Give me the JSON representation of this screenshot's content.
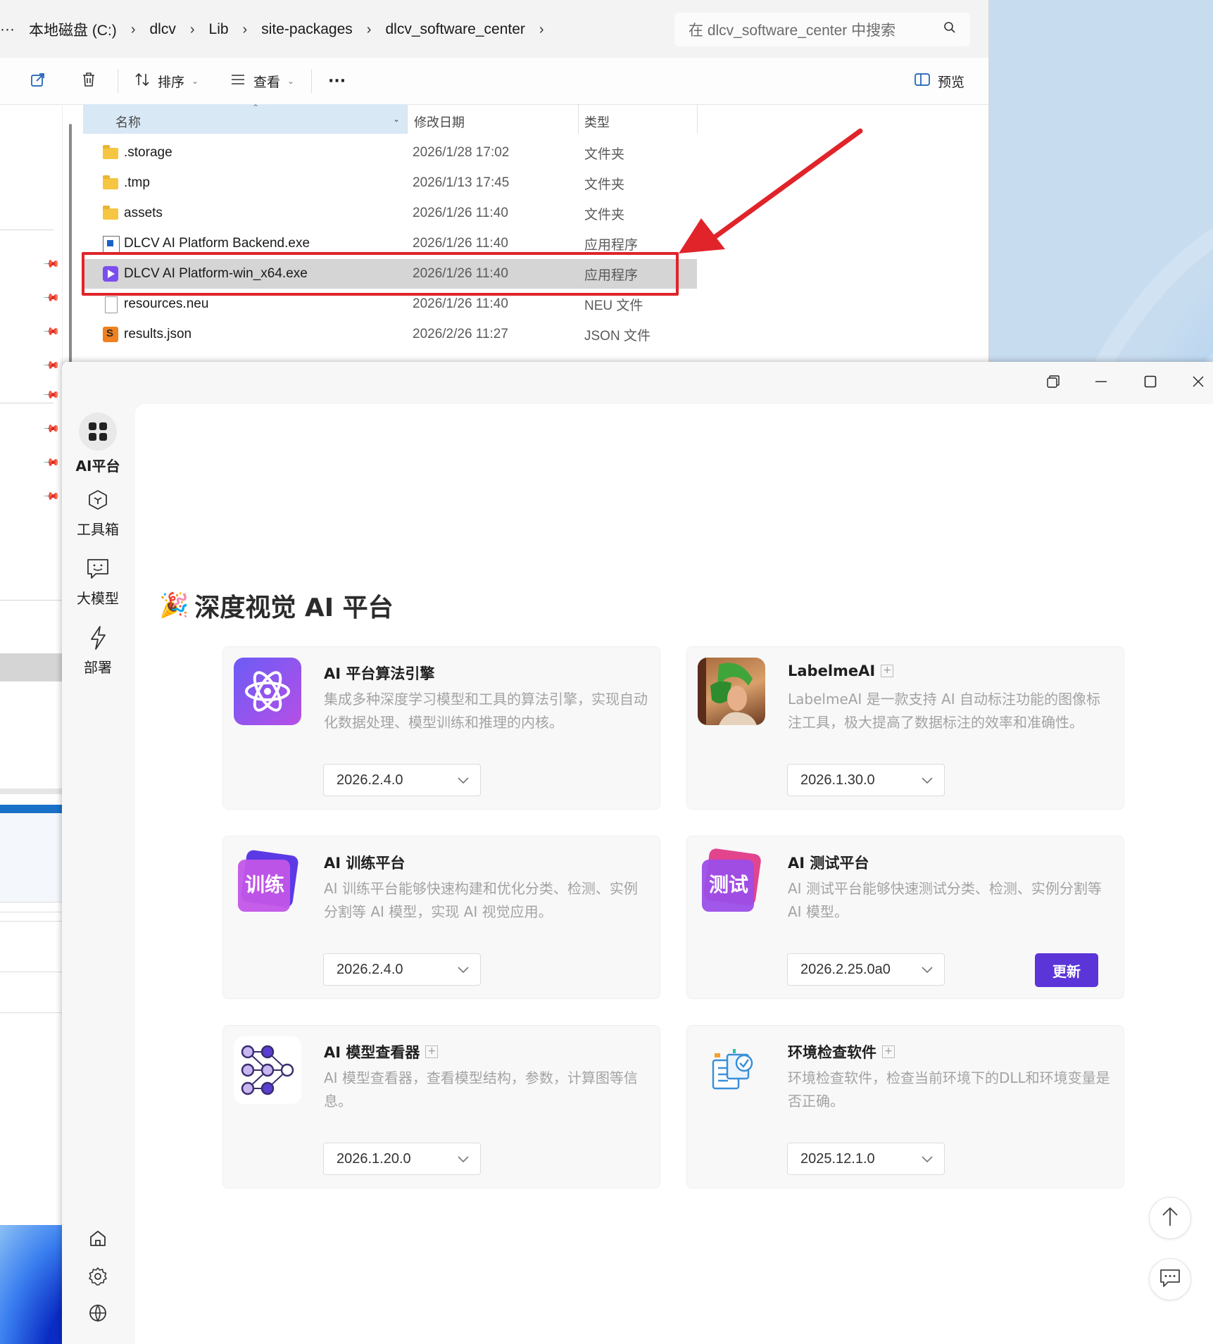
{
  "explorer": {
    "breadcrumbs": [
      "本地磁盘 (C:)",
      "dlcv",
      "Lib",
      "site-packages",
      "dlcv_software_center"
    ],
    "breadcrumb_lead": "···",
    "search_placeholder": "在 dlcv_software_center 中搜索",
    "toolbar": {
      "sort_label": "排序",
      "view_label": "查看",
      "more_label": "···",
      "preview_label": "预览"
    },
    "columns": {
      "name": "名称",
      "date": "修改日期",
      "type": "类型"
    },
    "files": [
      {
        "name": ".storage",
        "date": "2026/1/28 17:02",
        "type": "文件夹",
        "icon": "folder-icon"
      },
      {
        "name": ".tmp",
        "date": "2026/1/13 17:45",
        "type": "文件夹",
        "icon": "folder-icon"
      },
      {
        "name": "assets",
        "date": "2026/1/26 11:40",
        "type": "文件夹",
        "icon": "folder-icon"
      },
      {
        "name": "DLCV AI Platform Backend.exe",
        "date": "2026/1/26 11:40",
        "type": "应用程序",
        "icon": "exe-icon"
      },
      {
        "name": "DLCV AI Platform-win_x64.exe",
        "date": "2026/1/26 11:40",
        "type": "应用程序",
        "icon": "app-icon",
        "selected": true
      },
      {
        "name": "resources.neu",
        "date": "2026/1/26 11:40",
        "type": "NEU 文件",
        "icon": "document-icon"
      },
      {
        "name": "results.json",
        "date": "2026/2/26 11:27",
        "type": "JSON 文件",
        "icon": "json-icon"
      }
    ]
  },
  "app": {
    "sidebar": [
      {
        "label": "AI平台",
        "icon": "grid-icon",
        "active": true
      },
      {
        "label": "工具箱",
        "icon": "cube-icon"
      },
      {
        "label": "大模型",
        "icon": "chat-icon"
      },
      {
        "label": "部署",
        "icon": "bolt-icon"
      }
    ],
    "page_title": "深度视觉 AI 平台",
    "title_emoji": "🎉",
    "cards": [
      {
        "name": "AI 平台算法引擎",
        "desc": "集成多种深度学习模型和工具的算法引擎，实现自动化数据处理、模型训练和推理的内核。",
        "version": "2026.2.4.0",
        "icon": "atom-icon",
        "plus": false
      },
      {
        "name": "LabelmeAI",
        "desc": "LabelmeAI 是一款支持 AI 自动标注功能的图像标注工具，极大提高了数据标注的效率和准确性。",
        "version": "2026.1.30.0",
        "icon": "labelme-logo-icon",
        "plus": true
      },
      {
        "name": "AI 训练平台",
        "desc": "AI 训练平台能够快速构建和优化分类、检测、实例分割等 AI 模型，实现 AI 视觉应用。",
        "version": "2026.2.4.0",
        "icon": "train-logo-icon",
        "logo_text": "训练",
        "plus": false
      },
      {
        "name": "AI 测试平台",
        "desc": "AI 测试平台能够快速测试分类、检测、实例分割等 AI 模型。",
        "version": "2026.2.25.0a0",
        "icon": "test-logo-icon",
        "logo_text": "测试",
        "plus": false,
        "action": "更新"
      },
      {
        "name": "AI 模型查看器",
        "desc": "AI 模型查看器，查看模型结构，参数，计算图等信息。",
        "version": "2026.1.20.0",
        "icon": "network-icon",
        "plus": true
      },
      {
        "name": "环境检查软件",
        "desc": "环境检查软件，检查当前环境下的DLL和环境变量是否正确。",
        "version": "2025.12.1.0",
        "icon": "checklist-icon",
        "plus": true
      }
    ]
  },
  "colors": {
    "accent": "#5b35d8",
    "highlight_box": "#e0242a",
    "selection": "#d5d5d5"
  }
}
